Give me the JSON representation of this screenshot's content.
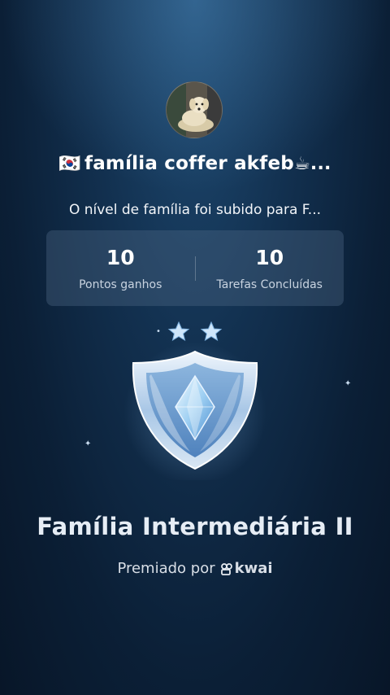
{
  "header": {
    "family_flag": "🇰🇷",
    "family_name": "família coffer akfeb",
    "family_suffix": "☕...",
    "level_message": "O nível de família foi subido para F..."
  },
  "stats": [
    {
      "value": "10",
      "label": "Pontos ganhos"
    },
    {
      "value": "10",
      "label": "Tarefas Concluídas"
    }
  ],
  "badge": {
    "stars": 2,
    "title": "Família Intermediária II"
  },
  "footer": {
    "awarded_by": "Premiado por",
    "brand": "kwai"
  }
}
